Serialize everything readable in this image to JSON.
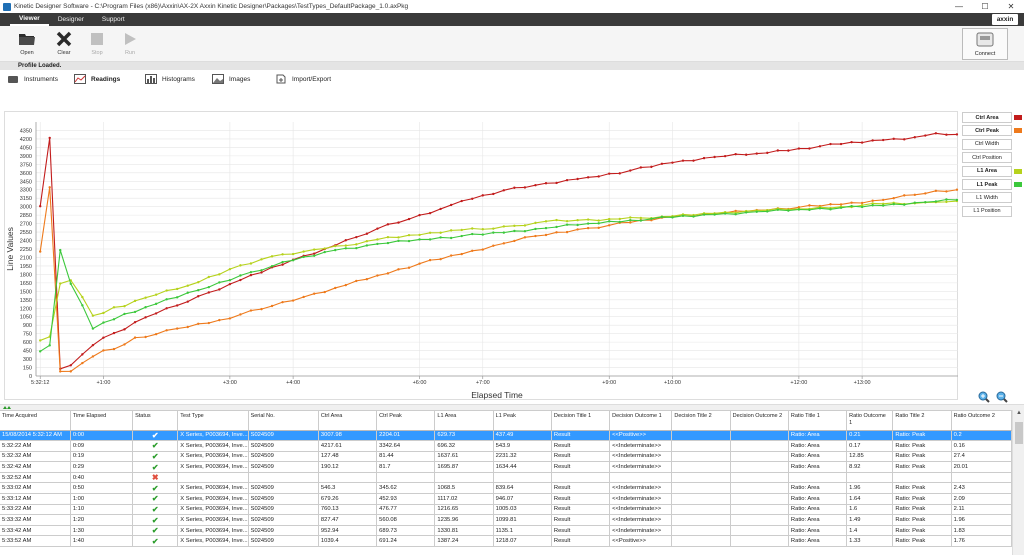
{
  "window": {
    "title": "Kinetic Designer Software - C:\\Program Files (x86)\\Axxin\\AX-2X Axxin Kinetic Designer\\Packages\\TestTypes_DefaultPackage_1.0.axPkg",
    "minimize": "—",
    "maximize": "☐",
    "close": "✕"
  },
  "menu": {
    "tabs": [
      "Viewer",
      "Designer",
      "Support"
    ],
    "brand": "axxin"
  },
  "ribbon": {
    "open": "Open",
    "clear": "Clear",
    "stop": "Stop",
    "run": "Run",
    "connect": "Connect"
  },
  "status": "Profile Loaded.",
  "nav": {
    "instruments": "Instruments",
    "readings": "Readings",
    "histograms": "Histograms",
    "images": "Images",
    "import_export": "Import/Export"
  },
  "legend": [
    {
      "label": "Ctrl Area",
      "bold": true,
      "color": "#c21c1c"
    },
    {
      "label": "Ctrl Peak",
      "bold": true,
      "color": "#ee7a1c"
    },
    {
      "label": "Ctrl Width",
      "bold": false,
      "color": ""
    },
    {
      "label": "Ctrl Position",
      "bold": false,
      "color": ""
    },
    {
      "label": "L1 Area",
      "bold": true,
      "color": "#b6d21c"
    },
    {
      "label": "L1 Peak",
      "bold": true,
      "color": "#3cc83c"
    },
    {
      "label": "L1 Width",
      "bold": false,
      "color": ""
    },
    {
      "label": "L1 Position",
      "bold": false,
      "color": ""
    }
  ],
  "chart_data": {
    "type": "line",
    "xlabel": "Elapsed Time",
    "ylabel": "Line Values",
    "ylim": [
      0,
      4500
    ],
    "yticks": [
      0,
      150,
      300,
      450,
      600,
      750,
      900,
      1050,
      1200,
      1350,
      1500,
      1650,
      1800,
      1950,
      2100,
      2250,
      2400,
      2550,
      2700,
      2850,
      3000,
      3150,
      3300,
      3450,
      3600,
      3750,
      3900,
      4050,
      4200,
      4350
    ],
    "xlim": [
      -4,
      871
    ],
    "xticks": [
      {
        "v": 0,
        "label": "5:32:12"
      },
      {
        "v": 60,
        "label": "+1:00"
      },
      {
        "v": 180,
        "label": "+3:00"
      },
      {
        "v": 240,
        "label": "+4:00"
      },
      {
        "v": 360,
        "label": "+6:00"
      },
      {
        "v": 420,
        "label": "+7:00"
      },
      {
        "v": 540,
        "label": "+9:00"
      },
      {
        "v": 600,
        "label": "+10:00"
      },
      {
        "v": 720,
        "label": "+12:00"
      },
      {
        "v": 780,
        "label": "+13:00"
      }
    ],
    "grid": true,
    "legend": "right",
    "series": [
      {
        "name": "Ctrl Area",
        "color": "#c21c1c",
        "anchors": [
          [
            0,
            3008
          ],
          [
            9,
            4218
          ],
          [
            19,
            127
          ],
          [
            29,
            190
          ],
          [
            50,
            546
          ],
          [
            60,
            679
          ],
          [
            70,
            760
          ],
          [
            80,
            827
          ],
          [
            90,
            953
          ],
          [
            100,
            1039
          ],
          [
            130,
            1250
          ],
          [
            160,
            1480
          ],
          [
            190,
            1700
          ],
          [
            240,
            2060
          ],
          [
            270,
            2250
          ],
          [
            300,
            2460
          ],
          [
            320,
            2610
          ],
          [
            350,
            2780
          ],
          [
            380,
            2960
          ],
          [
            400,
            3100
          ],
          [
            420,
            3200
          ],
          [
            440,
            3290
          ],
          [
            470,
            3380
          ],
          [
            500,
            3470
          ],
          [
            520,
            3520
          ],
          [
            560,
            3640
          ],
          [
            600,
            3780
          ],
          [
            640,
            3880
          ],
          [
            680,
            3940
          ],
          [
            720,
            4030
          ],
          [
            760,
            4110
          ],
          [
            800,
            4180
          ],
          [
            830,
            4230
          ],
          [
            850,
            4300
          ],
          [
            870,
            4280
          ]
        ]
      },
      {
        "name": "Ctrl Peak",
        "color": "#ee7a1c",
        "anchors": [
          [
            0,
            2204
          ],
          [
            9,
            3343
          ],
          [
            19,
            81
          ],
          [
            29,
            82
          ],
          [
            50,
            346
          ],
          [
            60,
            453
          ],
          [
            70,
            477
          ],
          [
            80,
            560
          ],
          [
            90,
            680
          ],
          [
            100,
            691
          ],
          [
            130,
            840
          ],
          [
            170,
            990
          ],
          [
            220,
            1240
          ],
          [
            250,
            1400
          ],
          [
            280,
            1560
          ],
          [
            320,
            1780
          ],
          [
            360,
            1990
          ],
          [
            400,
            2160
          ],
          [
            440,
            2350
          ],
          [
            470,
            2480
          ],
          [
            520,
            2620
          ],
          [
            560,
            2720
          ],
          [
            600,
            2820
          ],
          [
            640,
            2880
          ],
          [
            680,
            2940
          ],
          [
            720,
            2990
          ],
          [
            760,
            3040
          ],
          [
            800,
            3120
          ],
          [
            830,
            3210
          ],
          [
            850,
            3280
          ],
          [
            870,
            3300
          ]
        ]
      },
      {
        "name": "L1 Area",
        "color": "#b6d21c",
        "anchors": [
          [
            0,
            630
          ],
          [
            9,
            696
          ],
          [
            19,
            1638
          ],
          [
            29,
            1696
          ],
          [
            50,
            1069
          ],
          [
            60,
            1117
          ],
          [
            70,
            1217
          ],
          [
            80,
            1236
          ],
          [
            90,
            1331
          ],
          [
            100,
            1387
          ],
          [
            140,
            1600
          ],
          [
            190,
            1960
          ],
          [
            220,
            2120
          ],
          [
            240,
            2160
          ],
          [
            260,
            2240
          ],
          [
            290,
            2310
          ],
          [
            320,
            2420
          ],
          [
            360,
            2500
          ],
          [
            390,
            2580
          ],
          [
            420,
            2600
          ],
          [
            450,
            2660
          ],
          [
            480,
            2740
          ],
          [
            510,
            2760
          ],
          [
            540,
            2780
          ],
          [
            570,
            2800
          ],
          [
            600,
            2830
          ],
          [
            640,
            2880
          ],
          [
            680,
            2930
          ],
          [
            720,
            2960
          ],
          [
            760,
            3000
          ],
          [
            800,
            3050
          ],
          [
            830,
            3060
          ],
          [
            850,
            3080
          ],
          [
            870,
            3100
          ]
        ]
      },
      {
        "name": "L1 Peak",
        "color": "#3cc83c",
        "anchors": [
          [
            0,
            437
          ],
          [
            9,
            543
          ],
          [
            19,
            2231
          ],
          [
            29,
            1634
          ],
          [
            50,
            840
          ],
          [
            60,
            946
          ],
          [
            70,
            1005
          ],
          [
            80,
            1100
          ],
          [
            90,
            1135
          ],
          [
            100,
            1218
          ],
          [
            150,
            1520
          ],
          [
            200,
            1840
          ],
          [
            240,
            2050
          ],
          [
            280,
            2230
          ],
          [
            320,
            2340
          ],
          [
            360,
            2420
          ],
          [
            400,
            2480
          ],
          [
            440,
            2540
          ],
          [
            480,
            2620
          ],
          [
            520,
            2700
          ],
          [
            560,
            2760
          ],
          [
            600,
            2810
          ],
          [
            640,
            2860
          ],
          [
            680,
            2910
          ],
          [
            720,
            2950
          ],
          [
            760,
            2980
          ],
          [
            800,
            3020
          ],
          [
            840,
            3080
          ],
          [
            870,
            3120
          ]
        ]
      }
    ]
  },
  "table": {
    "headers": [
      "Time Acquired",
      "Time Elapsed",
      "Status",
      "Test Type",
      "Serial No.",
      "Ctrl Area",
      "Ctrl Peak",
      "L1 Area",
      "L1 Peak",
      "Decision Title 1",
      "Decision Outcome 1",
      "Decision Title 2",
      "Decision Outcome 2",
      "Ratio Title 1",
      "Ratio Outcome 1",
      "Ratio Title 2",
      "Ratio Outcome 2"
    ],
    "rows": [
      [
        "15/08/2014 5:32:12 AM",
        "0:00",
        "ok",
        "X Series, P003694, Inve...",
        "S024509",
        "3007.98",
        "2204.01",
        "629.73",
        "437.49",
        "Result",
        "<<Positive>>",
        "",
        "",
        "Ratio: Area",
        "0.21",
        "Ratio: Peak",
        "0.2"
      ],
      [
        "5:32:22 AM",
        "0:09",
        "ok",
        "X Series, P003694, Inve...",
        "S024509",
        "4217.61",
        "3342.64",
        "696.32",
        "543.9",
        "Result",
        "<<Indeterminate>>",
        "",
        "",
        "Ratio: Area",
        "0.17",
        "Ratio: Peak",
        "0.16"
      ],
      [
        "5:32:32 AM",
        "0:19",
        "ok",
        "X Series, P003694, Inve...",
        "S024509",
        "127.48",
        "81.44",
        "1637.61",
        "2231.32",
        "Result",
        "<<Indeterminate>>",
        "",
        "",
        "Ratio: Area",
        "12.85",
        "Ratio: Peak",
        "27.4"
      ],
      [
        "5:32:42 AM",
        "0:29",
        "ok",
        "X Series, P003694, Inve...",
        "S024509",
        "190.12",
        "81.7",
        "1695.87",
        "1634.44",
        "Result",
        "<<Indeterminate>>",
        "",
        "",
        "Ratio: Area",
        "8.92",
        "Ratio: Peak",
        "20.01"
      ],
      [
        "5:32:52 AM",
        "0:40",
        "err",
        "",
        "",
        "",
        "",
        "",
        "",
        "",
        "",
        "",
        "",
        "",
        "",
        "",
        ""
      ],
      [
        "5:33:02 AM",
        "0:50",
        "ok",
        "X Series, P003694, Inve...",
        "S024509",
        "546.3",
        "345.62",
        "1068.5",
        "839.64",
        "Result",
        "<<Indeterminate>>",
        "",
        "",
        "Ratio: Area",
        "1.96",
        "Ratio: Peak",
        "2.43"
      ],
      [
        "5:33:12 AM",
        "1:00",
        "ok",
        "X Series, P003694, Inve...",
        "S024509",
        "679.26",
        "452.93",
        "1117.02",
        "946.07",
        "Result",
        "<<Indeterminate>>",
        "",
        "",
        "Ratio: Area",
        "1.64",
        "Ratio: Peak",
        "2.09"
      ],
      [
        "5:33:22 AM",
        "1:10",
        "ok",
        "X Series, P003694, Inve...",
        "S024509",
        "760.13",
        "476.77",
        "1216.65",
        "1005.03",
        "Result",
        "<<Indeterminate>>",
        "",
        "",
        "Ratio: Area",
        "1.6",
        "Ratio: Peak",
        "2.11"
      ],
      [
        "5:33:32 AM",
        "1:20",
        "ok",
        "X Series, P003694, Inve...",
        "S024509",
        "827.47",
        "560.08",
        "1235.96",
        "1099.81",
        "Result",
        "<<Indeterminate>>",
        "",
        "",
        "Ratio: Area",
        "1.49",
        "Ratio: Peak",
        "1.96"
      ],
      [
        "5:33:42 AM",
        "1:30",
        "ok",
        "X Series, P003694, Inve...",
        "S024509",
        "952.94",
        "689.73",
        "1330.81",
        "1135.1",
        "Result",
        "<<Indeterminate>>",
        "",
        "",
        "Ratio: Area",
        "1.4",
        "Ratio: Peak",
        "1.83"
      ],
      [
        "5:33:52 AM",
        "1:40",
        "ok",
        "X Series, P003694, Inve...",
        "S024509",
        "1039.4",
        "691.24",
        "1387.24",
        "1218.07",
        "Result",
        "<<Positive>>",
        "",
        "",
        "Ratio: Area",
        "1.33",
        "Ratio: Peak",
        "1.76"
      ]
    ]
  }
}
